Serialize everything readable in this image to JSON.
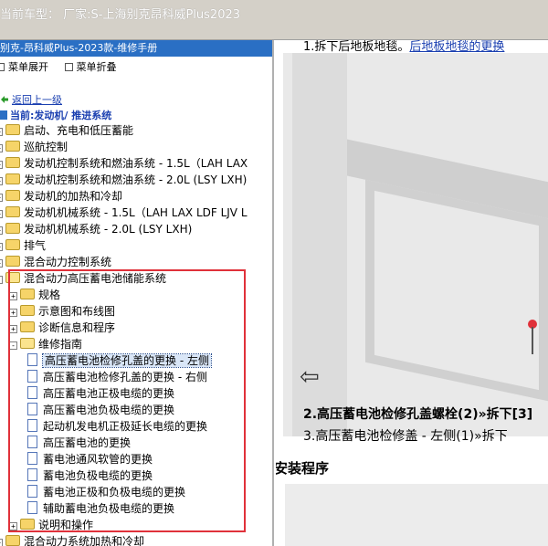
{
  "window": {
    "title": "当前车型： 厂家:S-上海别克昂科威Plus2023"
  },
  "left_panel": {
    "header": "别克-昂科威Plus-2023款-维修手册",
    "toolbar": {
      "expand_label": "菜单展开",
      "collapse_label": "菜单折叠"
    },
    "back_link": "返回上一级",
    "current_path": "当前:发动机/ 推进系统",
    "tree": [
      {
        "label": "启动、充电和低压蓄能",
        "level": 0,
        "type": "folder",
        "expander": "+"
      },
      {
        "label": "巡航控制",
        "level": 0,
        "type": "folder",
        "expander": "+"
      },
      {
        "label": "发动机控制系统和燃油系统 - 1.5L（LAH LAX",
        "level": 0,
        "type": "folder",
        "expander": "+"
      },
      {
        "label": "发动机控制系统和燃油系统 - 2.0L (LSY LXH)",
        "level": 0,
        "type": "folder",
        "expander": "+"
      },
      {
        "label": "发动机的加热和冷却",
        "level": 0,
        "type": "folder",
        "expander": "+"
      },
      {
        "label": "发动机机械系统 - 1.5L（LAH LAX LDF LJV L",
        "level": 0,
        "type": "folder",
        "expander": "+"
      },
      {
        "label": "发动机机械系统 - 2.0L (LSY LXH)",
        "level": 0,
        "type": "folder",
        "expander": "+"
      },
      {
        "label": "排气",
        "level": 0,
        "type": "folder",
        "expander": "+"
      },
      {
        "label": "混合动力控制系统",
        "level": 0,
        "type": "folder",
        "expander": "+"
      },
      {
        "label": "混合动力高压蓄电池储能系统",
        "level": 0,
        "type": "folder-open",
        "expander": "-"
      },
      {
        "label": "规格",
        "level": 1,
        "type": "folder",
        "expander": "+"
      },
      {
        "label": "示意图和布线图",
        "level": 1,
        "type": "folder",
        "expander": "+"
      },
      {
        "label": "诊断信息和程序",
        "level": 1,
        "type": "folder",
        "expander": "+"
      },
      {
        "label": "维修指南",
        "level": 1,
        "type": "folder-open",
        "expander": "-"
      },
      {
        "label": "高压蓄电池检修孔盖的更换 - 左侧",
        "level": 2,
        "type": "doc",
        "selected": true
      },
      {
        "label": "高压蓄电池检修孔盖的更换 - 右侧",
        "level": 2,
        "type": "doc"
      },
      {
        "label": "高压蓄电池正极电缆的更换",
        "level": 2,
        "type": "doc"
      },
      {
        "label": "高压蓄电池负极电缆的更换",
        "level": 2,
        "type": "doc"
      },
      {
        "label": "起动机发电机正极延长电缆的更换",
        "level": 2,
        "type": "doc"
      },
      {
        "label": "高压蓄电池的更换",
        "level": 2,
        "type": "doc"
      },
      {
        "label": "蓄电池通风软管的更换",
        "level": 2,
        "type": "doc"
      },
      {
        "label": "蓄电池负极电缆的更换",
        "level": 2,
        "type": "doc"
      },
      {
        "label": "蓄电池正极和负极电缆的更换",
        "level": 2,
        "type": "doc"
      },
      {
        "label": "辅助蓄电池负极电缆的更换",
        "level": 2,
        "type": "doc"
      },
      {
        "label": "说明和操作",
        "level": 1,
        "type": "folder",
        "expander": "+"
      },
      {
        "label": "混合动力系统加热和冷却",
        "level": 0,
        "type": "folder",
        "expander": "+"
      }
    ]
  },
  "content": {
    "step1_prefix": "1.拆下后地板地毯。",
    "step1_link": "后地板地毯的更换",
    "step2": "2.高压蓄电池检修孔盖螺栓(2)»拆下[3]",
    "step3": "3.高压蓄电池检修盖 - 左侧(1)»拆下",
    "install_title": "安装程序"
  }
}
